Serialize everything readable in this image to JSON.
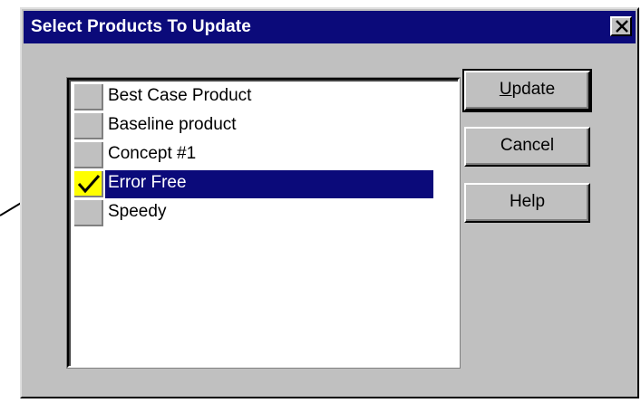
{
  "window": {
    "title": "Select Products To Update",
    "close_glyph": "×"
  },
  "list": {
    "items": [
      {
        "label": "Best Case Product",
        "checked": false,
        "selected": false
      },
      {
        "label": "Baseline product",
        "checked": false,
        "selected": false
      },
      {
        "label": "Concept #1",
        "checked": false,
        "selected": false
      },
      {
        "label": "Error Free",
        "checked": true,
        "selected": true
      },
      {
        "label": "Speedy",
        "checked": false,
        "selected": false
      }
    ]
  },
  "buttons": {
    "update_mnemonic": "U",
    "update_rest": "pdate",
    "cancel": "Cancel",
    "help": "Help"
  },
  "colors": {
    "title_bar": "#0b0a7a",
    "selection": "#0b0a7a",
    "check_fill": "#ffff00",
    "face": "#c0c0c0"
  },
  "icons": {
    "close": "close-icon",
    "check": "checkmark-icon",
    "annotation": "pointer-arrow-icon"
  }
}
